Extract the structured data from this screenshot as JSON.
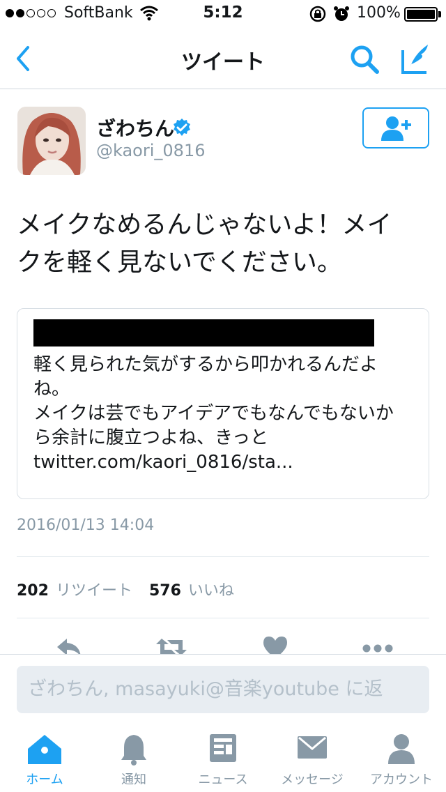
{
  "status_bar": {
    "carrier": "SoftBank",
    "time": "5:12",
    "battery": "100%"
  },
  "nav": {
    "title": "ツイート"
  },
  "tweet": {
    "display_name": "ざわちん",
    "handle": "@kaori_0816",
    "text": "メイクなめるんじゃないよ！メイクを軽く見ないでください。",
    "quoted": {
      "text_lines": [
        "軽く見られた気がするから叩かれるんだよね。",
        "メイクは芸でもアイデアでもなんでもないから余計に腹立つよね、きっと",
        "twitter.com/kaori_0816/sta..."
      ]
    },
    "timestamp": "2016/01/13 14:04",
    "retweet_count": "202",
    "retweet_label": "リツイート",
    "like_count": "576",
    "like_label": "いいね"
  },
  "reply": {
    "placeholder": "ざわちん, masayuki@音楽youtube に返"
  },
  "tabs": [
    {
      "label": "ホーム",
      "icon": "home-icon",
      "active": true
    },
    {
      "label": "通知",
      "icon": "bell-icon",
      "active": false
    },
    {
      "label": "ニュース",
      "icon": "news-icon",
      "active": false
    },
    {
      "label": "メッセージ",
      "icon": "envelope-icon",
      "active": false
    },
    {
      "label": "アカウント",
      "icon": "person-icon",
      "active": false
    }
  ],
  "colors": {
    "accent": "#1da1f2",
    "muted": "#8899a6",
    "text": "#14171a"
  }
}
